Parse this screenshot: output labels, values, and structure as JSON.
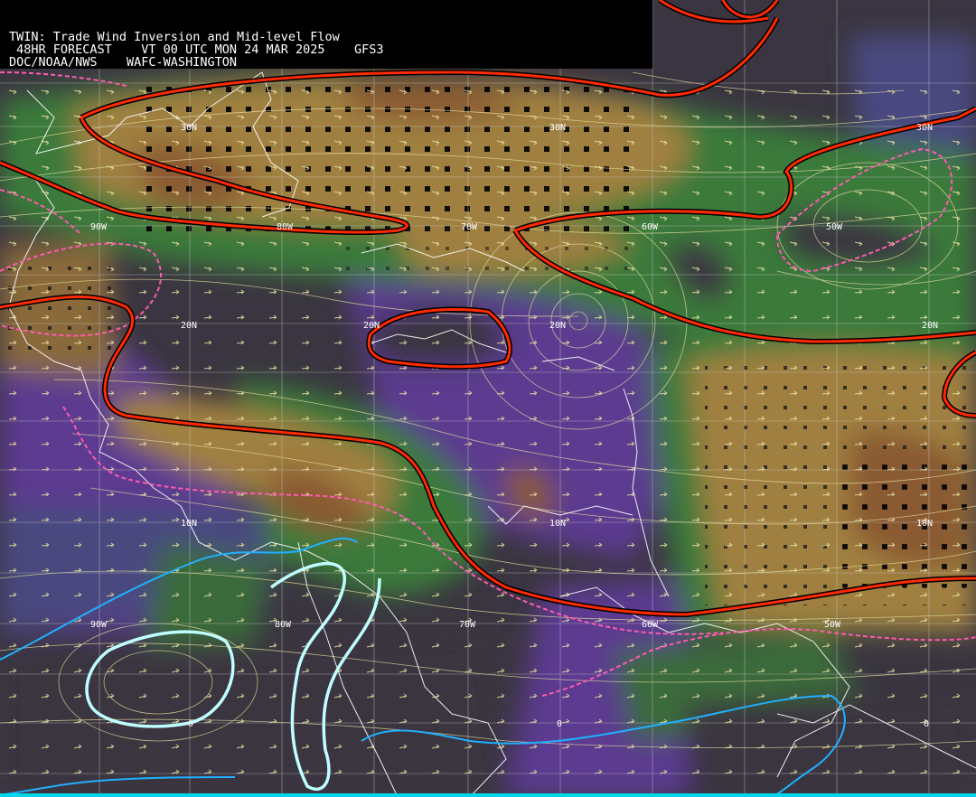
{
  "header": {
    "line1": "TWIN: Trade Wind Inversion and Mid-level Flow",
    "line2": " 48HR FORECAST    VT 00 UTC MON 24 MAR 2025    GFS3",
    "line3": "DOC/NOAA/NWS    WAFC-WASHINGTON"
  },
  "grid_labels": {
    "lat_30n": [
      "30N",
      "30N",
      "30N"
    ],
    "lat_20n": [
      "20N",
      "20N",
      "20N",
      "20N"
    ],
    "lat_10n": [
      "10N",
      "10N",
      "10N"
    ],
    "lat_0": [
      "0",
      "0",
      "0"
    ],
    "lon_top": [
      "90W",
      "80W",
      "70W",
      "60W",
      "50W"
    ],
    "lon_bottom": [
      "90W",
      "80W",
      "70W",
      "60W",
      "50W"
    ]
  },
  "colors": {
    "land_brown": "#8a5a30",
    "dry_tan": "#a08040",
    "green": "#3a7a3a",
    "dark_green": "#2e5e3a",
    "purple": "#6a3aa0",
    "slate_blue": "#4a4a80",
    "dark_gray": "#3a3540",
    "red_contour": "#ff2a00",
    "pink_dashed": "#ff5ab0",
    "cyan_contour": "#20b0ff",
    "streamline": "#e8e0a0",
    "grid": "#c8c8c8"
  },
  "legend_icons": [
    "wind-barb-icon",
    "inversion-marker-icon"
  ]
}
